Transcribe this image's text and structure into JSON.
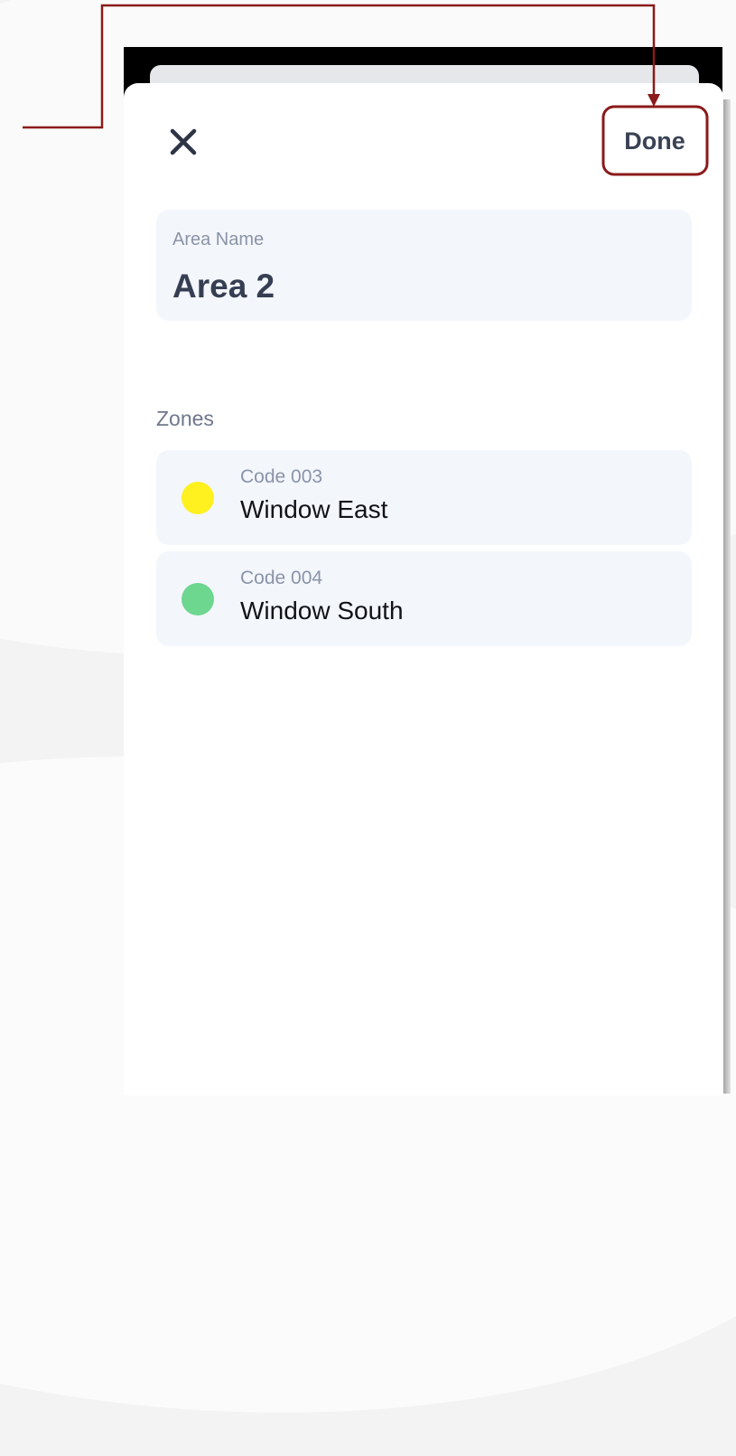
{
  "header": {
    "close_icon": "close-icon",
    "done_label": "Done"
  },
  "area_field": {
    "label": "Area Name",
    "value": "Area 2"
  },
  "zones": {
    "title": "Zones",
    "items": [
      {
        "code": "Code 003",
        "name": "Window East",
        "color": "#fff01f"
      },
      {
        "code": "Code 004",
        "name": "Window South",
        "color": "#6dd68f"
      }
    ]
  },
  "annotation": {
    "color": "#8b1a1a",
    "target": "Done"
  }
}
